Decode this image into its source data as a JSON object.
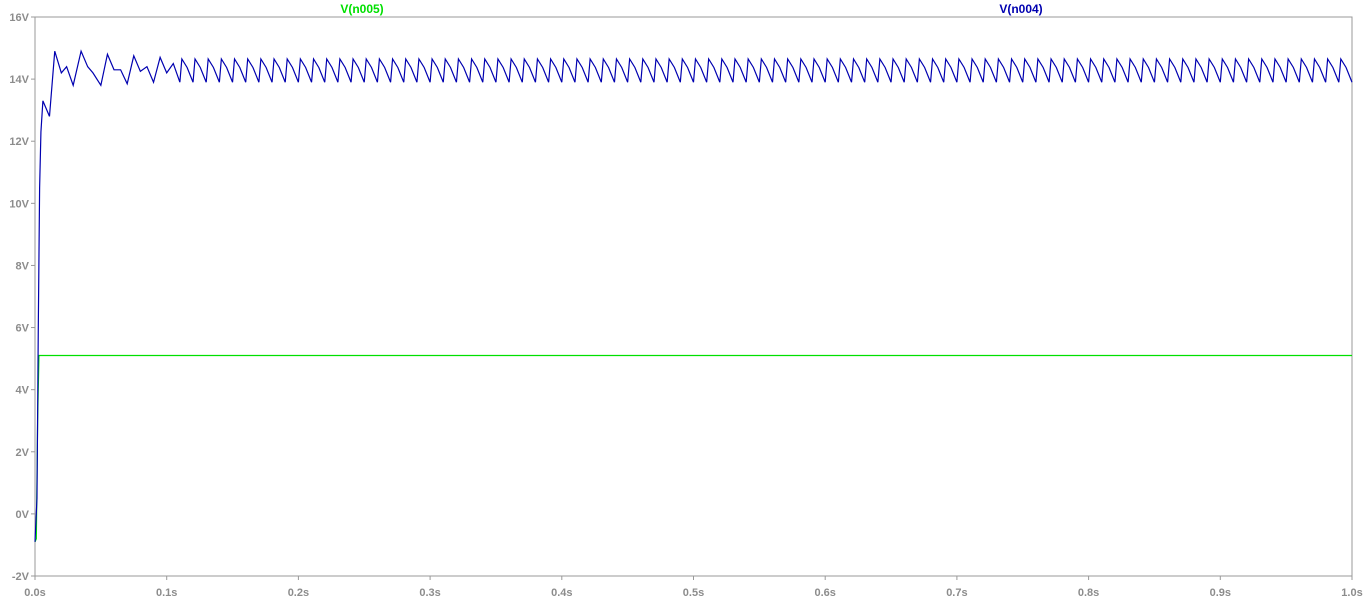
{
  "chart_data": {
    "type": "line",
    "title": "",
    "xlabel": "",
    "ylabel": "",
    "xlim": [
      0,
      1.0
    ],
    "ylim": [
      -2,
      16
    ],
    "x_ticks": [
      0,
      0.1,
      0.2,
      0.3,
      0.4,
      0.5,
      0.6,
      0.7,
      0.8,
      0.9,
      1.0
    ],
    "x_tick_labels": [
      "0.0s",
      "0.1s",
      "0.2s",
      "0.3s",
      "0.4s",
      "0.5s",
      "0.6s",
      "0.7s",
      "0.8s",
      "0.9s",
      "1.0s"
    ],
    "y_ticks": [
      -2,
      0,
      2,
      4,
      6,
      8,
      10,
      12,
      14,
      16
    ],
    "y_tick_labels": [
      "-2V",
      "0V",
      "2V",
      "4V",
      "6V",
      "8V",
      "10V",
      "12V",
      "14V",
      "16V"
    ],
    "grid": false,
    "legend_position": "top",
    "series": [
      {
        "name": "V(n005)",
        "color": "#00e000",
        "points": [
          [
            0.0,
            -0.9
          ],
          [
            0.001,
            -0.8
          ],
          [
            0.002,
            3.0
          ],
          [
            0.003,
            5.1
          ],
          [
            0.01,
            5.1
          ],
          [
            0.1,
            5.1
          ],
          [
            0.5,
            5.1
          ],
          [
            1.0,
            5.1
          ]
        ]
      },
      {
        "name": "V(n004)",
        "color": "#0000b0",
        "points": [
          [
            0.0,
            -0.9
          ],
          [
            0.0015,
            0.5
          ],
          [
            0.0025,
            6.0
          ],
          [
            0.0035,
            10.5
          ],
          [
            0.0045,
            12.3
          ],
          [
            0.006,
            13.3
          ],
          [
            0.011,
            12.8
          ],
          [
            0.015,
            14.9
          ],
          [
            0.02,
            14.2
          ],
          [
            0.024,
            14.4
          ],
          [
            0.029,
            13.8
          ],
          [
            0.035,
            14.9
          ],
          [
            0.04,
            14.4
          ],
          [
            0.044,
            14.2
          ],
          [
            0.05,
            13.8
          ],
          [
            0.055,
            14.8
          ],
          [
            0.06,
            14.3
          ],
          [
            0.065,
            14.3
          ],
          [
            0.07,
            13.85
          ],
          [
            0.075,
            14.75
          ],
          [
            0.08,
            14.25
          ],
          [
            0.085,
            14.4
          ],
          [
            0.09,
            13.9
          ],
          [
            0.095,
            14.7
          ],
          [
            0.1,
            14.2
          ],
          [
            0.105,
            14.5
          ],
          [
            0.11,
            13.9
          ]
        ],
        "steady_ripple": {
          "start": 0.11,
          "end": 1.0,
          "period": 0.01,
          "min": 13.9,
          "max": 14.65
        }
      }
    ]
  }
}
